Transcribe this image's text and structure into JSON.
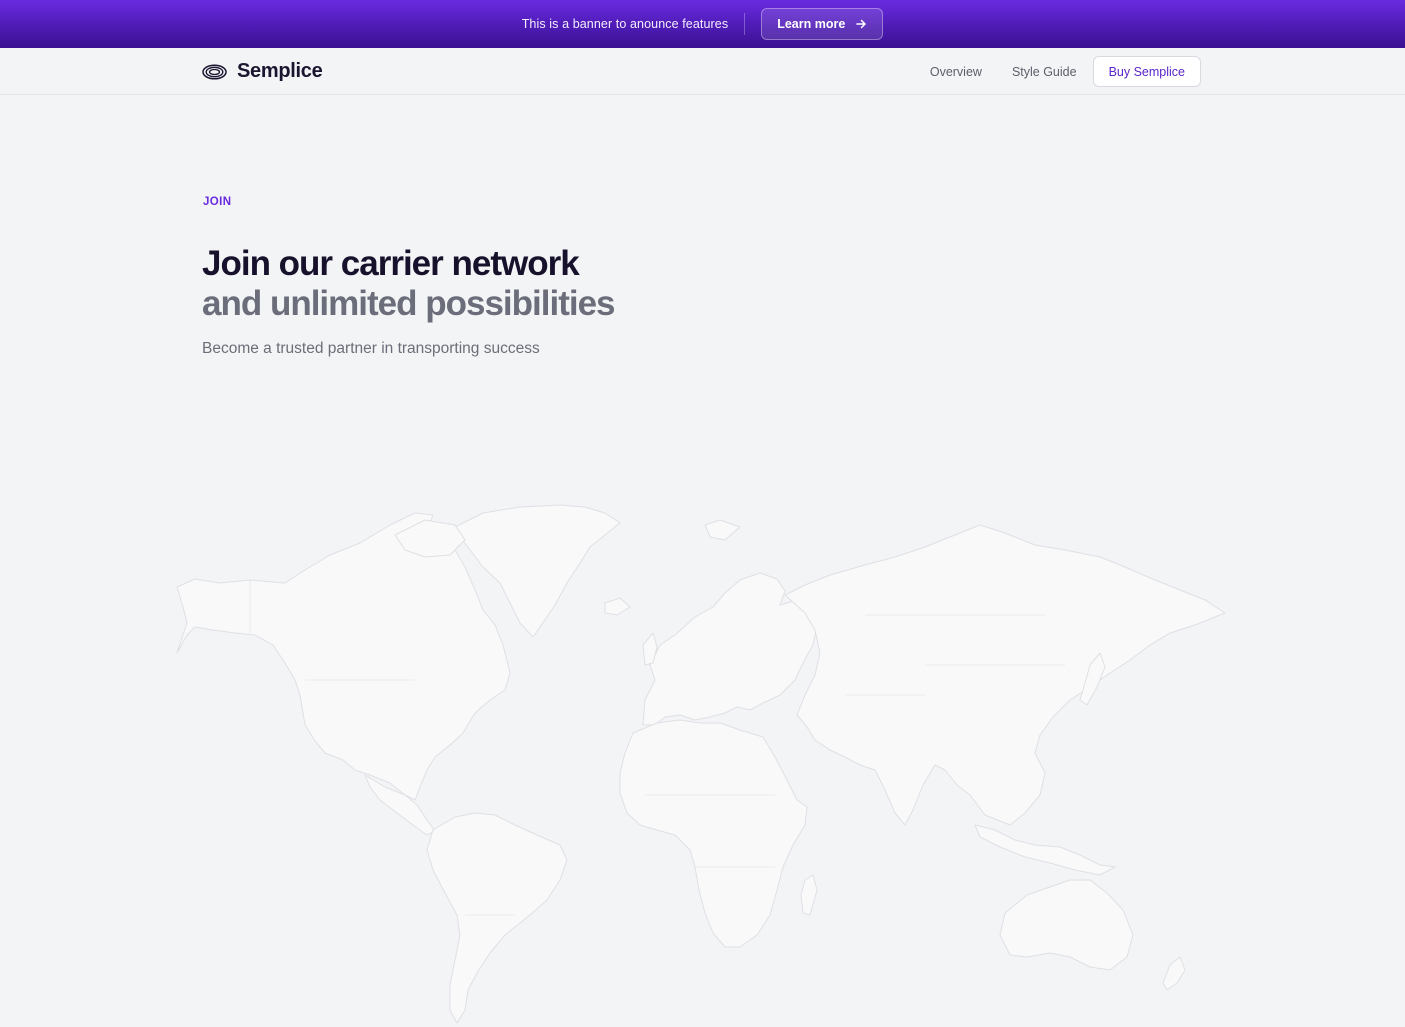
{
  "banner": {
    "text": "This is a banner to anounce features",
    "button_label": "Learn more",
    "button_icon": "arrow-right-icon"
  },
  "navbar": {
    "brand": "Semplice",
    "logo_icon": "semplice-logo-icon",
    "links": [
      "Overview",
      "Style Guide"
    ],
    "cta_label": "Buy Semplice"
  },
  "hero": {
    "eyebrow": "JOIN",
    "title_line1": "Join our carrier network",
    "title_line2": "and unlimited possibilities",
    "subtitle": "Become a trusted partner in transporting success"
  },
  "colors": {
    "accent": "#6a2be0",
    "banner_dark": "#3a1190",
    "page_bg": "#f3f4f6",
    "land": "#f9f9fa",
    "border": "#e2e3e6"
  }
}
